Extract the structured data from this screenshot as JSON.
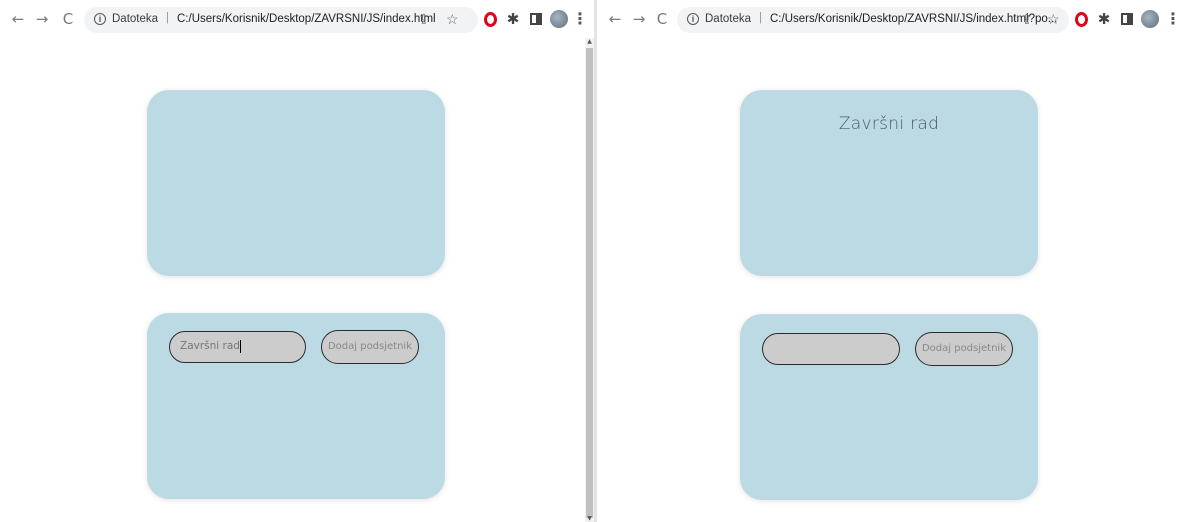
{
  "left": {
    "toolbar": {
      "back": "←",
      "forward": "→",
      "reload": "C",
      "info": "i",
      "chip": "Datoteka",
      "separator": "|",
      "url": "C:/Users/Korisnik/Desktop/ZAVRSNI/JS/index.html",
      "share": "⇪",
      "star": "☆",
      "menu": "⋮"
    },
    "input": {
      "value": "Završni rad",
      "placeholder": ""
    },
    "button_label": "Dodaj podsjetnik",
    "title": ""
  },
  "right": {
    "toolbar": {
      "back": "←",
      "forward": "→",
      "reload": "C",
      "info": "i",
      "chip": "Datoteka",
      "separator": "|",
      "url": "C:/Users/Korisnik/Desktop/ZAVRSNI/JS/index.html?po...",
      "share": "⇪",
      "star": "☆",
      "menu": "⋮"
    },
    "input": {
      "value": "",
      "placeholder": ""
    },
    "button_label": "Dodaj podsjetnik",
    "title": "Završni rad"
  },
  "colors": {
    "card": "#bbdae4",
    "pill": "#cccccc",
    "pill_border": "#2b2b2b",
    "opera": "#e2001a"
  }
}
